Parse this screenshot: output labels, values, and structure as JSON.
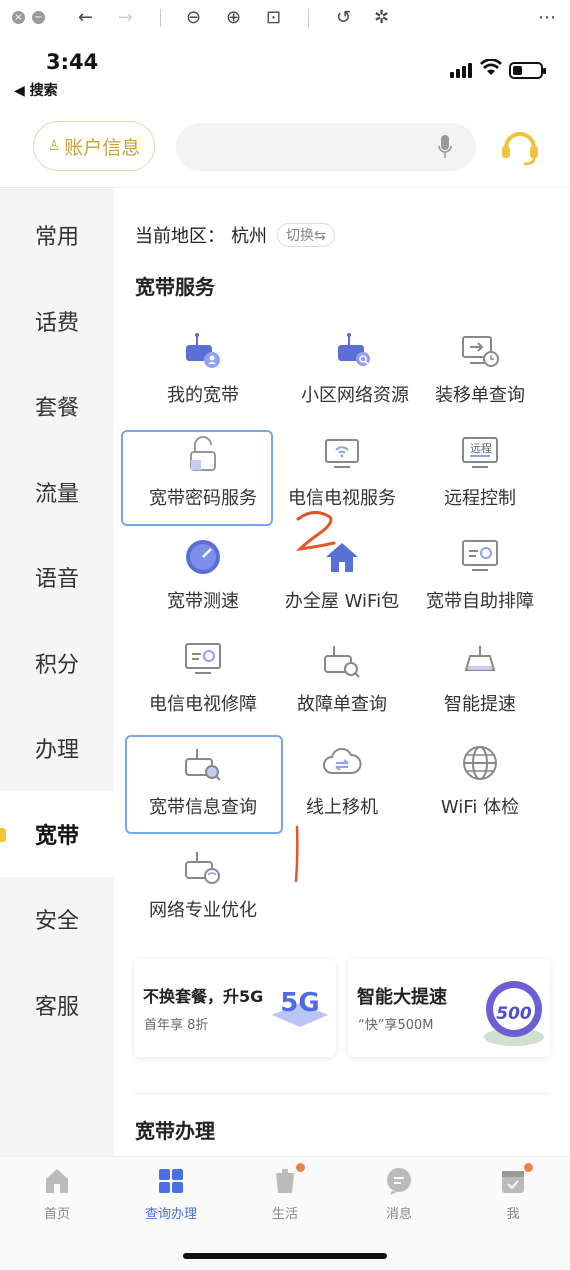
{
  "status_bar": {
    "time": "3:44",
    "back_app": "◀ 搜索",
    "battery_level": 0.35
  },
  "header": {
    "account_button": "账户信息"
  },
  "sidebar": {
    "items": [
      {
        "label": "常用"
      },
      {
        "label": "话费"
      },
      {
        "label": "套餐"
      },
      {
        "label": "流量"
      },
      {
        "label": "语音"
      },
      {
        "label": "积分"
      },
      {
        "label": "办理"
      },
      {
        "label": "宽带",
        "active": true
      },
      {
        "label": "安全"
      },
      {
        "label": "客服"
      }
    ]
  },
  "region": {
    "label": "当前地区：",
    "city": "杭州",
    "switch_label": "切换⇆"
  },
  "broadband_services": {
    "title": "宽带服务",
    "items": [
      {
        "label": "我的宽带",
        "icon": "router-user-icon"
      },
      {
        "label": "小区网络资源",
        "icon": "router-search-icon"
      },
      {
        "label": "装移单查询",
        "icon": "monitor-clock-icon"
      },
      {
        "label": "宽带密码服务",
        "icon": "lock-open-icon"
      },
      {
        "label": "电信电视服务",
        "icon": "tv-wifi-icon"
      },
      {
        "label": "远程控制",
        "icon": "remote-monitor-icon",
        "icon_text": "远程"
      },
      {
        "label": "宽带测速",
        "icon": "speedometer-icon"
      },
      {
        "label": "办全屋 WiFi包",
        "icon": "home-wifi-icon"
      },
      {
        "label": "宽带自助排障",
        "icon": "monitor-wave-icon"
      },
      {
        "label": "电信电视修障",
        "icon": "tv-repair-icon"
      },
      {
        "label": "故障单查询",
        "icon": "router-fault-search-icon"
      },
      {
        "label": "智能提速",
        "icon": "router-speed-icon"
      },
      {
        "label": "宽带信息查询",
        "icon": "router-info-search-icon"
      },
      {
        "label": "线上移机",
        "icon": "cloud-transfer-icon"
      },
      {
        "label": "WiFi 体检",
        "icon": "globe-icon"
      },
      {
        "label": "网络专业优化",
        "icon": "router-wifi-icon"
      }
    ]
  },
  "promos": [
    {
      "title": "不换套餐，升5G",
      "subtitle": "首年享 8折",
      "badge_text": "5G"
    },
    {
      "title": "智能大提速",
      "subtitle": "“快”享500M",
      "badge_text": "500"
    }
  ],
  "broadband_handling": {
    "title": "宽带办理"
  },
  "annotations": {
    "mark_1": "2",
    "mark_2": "|"
  },
  "tabbar": {
    "items": [
      {
        "label": "首页",
        "icon": "home-icon"
      },
      {
        "label": "查询办理",
        "icon": "grid-icon",
        "active": true
      },
      {
        "label": "生活",
        "icon": "bag-icon",
        "badge": true
      },
      {
        "label": "消息",
        "icon": "chat-icon"
      },
      {
        "label": "我",
        "icon": "calendar-icon",
        "badge": true
      }
    ]
  },
  "colors": {
    "accent_gold": "#c9a23a",
    "icon_blue": "#5a6fd6",
    "highlight_border": "#7aa7e8",
    "tab_active": "#4a6fe0",
    "annotation_red": "#e0582a"
  }
}
